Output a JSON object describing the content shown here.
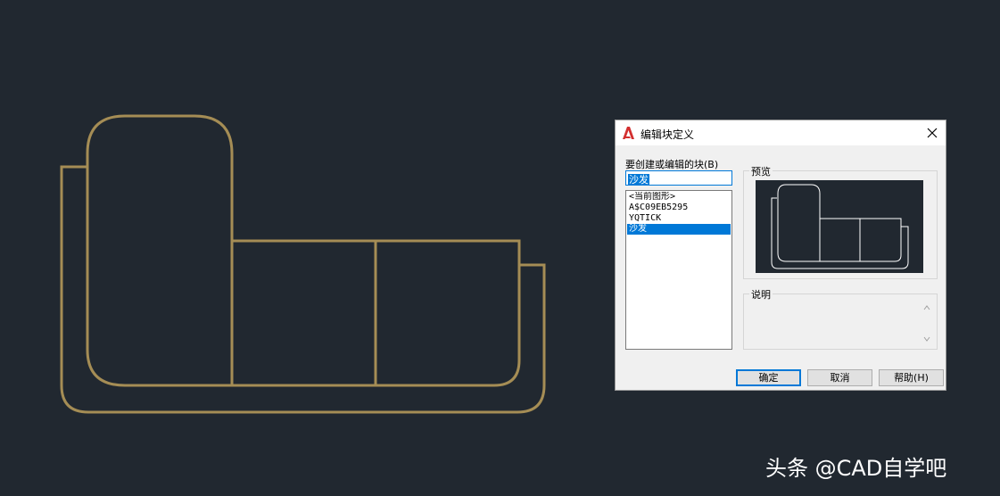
{
  "dialog": {
    "title": "编辑块定义",
    "blocks_label": "要创建或编辑的块(B)",
    "block_name_value": "沙发",
    "block_list": [
      "<当前图形>",
      "A$C09EB5295",
      "YQTICK",
      "沙发"
    ],
    "selected_block_index": 3,
    "preview_label": "预览",
    "description_label": "说明",
    "buttons": {
      "ok": "确定",
      "cancel": "取消",
      "help": "帮助(H)"
    }
  },
  "watermark": "头条 @CAD自学吧",
  "colors": {
    "canvas_bg": "#212830",
    "sofa_stroke": "#a58d55",
    "preview_stroke": "#ffffff",
    "selection": "#0078d7",
    "dialog_bg": "#f0f0f0",
    "app_icon": "#d32f2f"
  },
  "icons": {
    "app": "autocad-a-icon",
    "close": "close-icon",
    "scroll_up": "chevron-up-icon",
    "scroll_down": "chevron-down-icon"
  }
}
